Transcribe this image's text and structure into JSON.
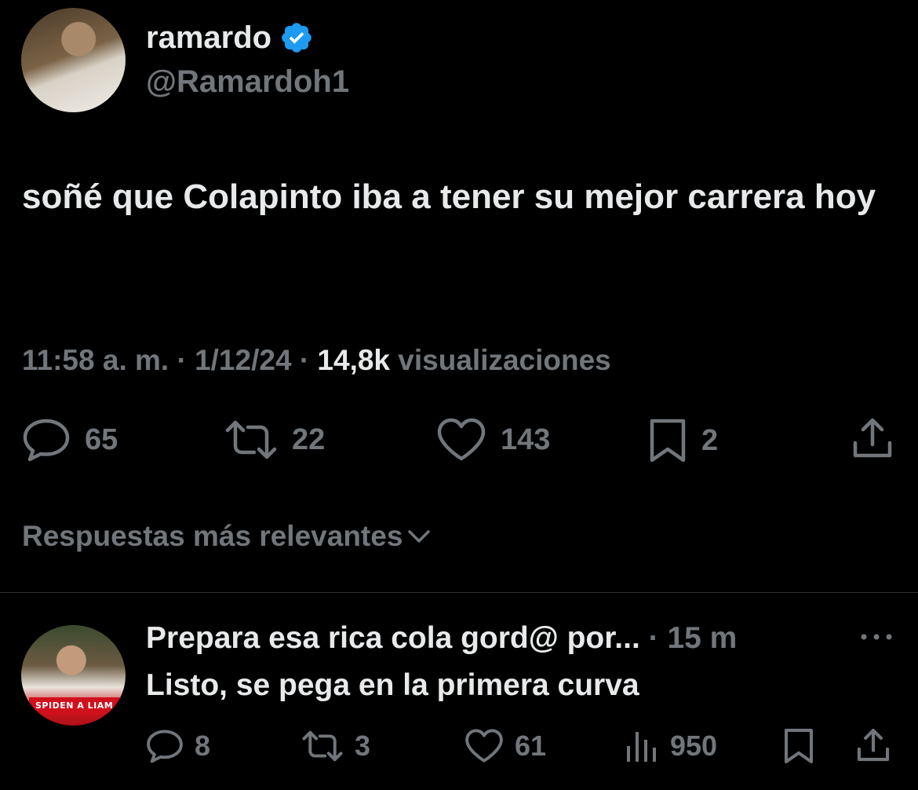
{
  "tweet": {
    "display_name": "ramardo",
    "handle": "@Ramardoh1",
    "verified": true,
    "verified_color": "#1d9bf0",
    "text": "soñé que Colapinto iba a tener su mejor carrera hoy",
    "time": "11:58 a. m.",
    "separator": "·",
    "date": "1/12/24",
    "views_count": "14,8k",
    "views_label": "visualizaciones",
    "actions": {
      "replies": "65",
      "retweets": "22",
      "likes": "143",
      "bookmarks": "2"
    },
    "icons": [
      "reply-icon",
      "retweet-icon",
      "like-icon",
      "bookmark-icon",
      "share-icon"
    ]
  },
  "replies_section": {
    "title": "Respuestas más relevantes"
  },
  "reply": {
    "author": "Prepara esa rica cola gord@ por...",
    "time": "· 15 m",
    "text": "Listo, se pega en la primera curva",
    "avatar_banner": "SPIDEN A LIAM",
    "actions": {
      "replies": "8",
      "retweets": "3",
      "likes": "61",
      "views": "950"
    }
  },
  "colors": {
    "background": "#000000",
    "primary_text": "#e7e9ea",
    "secondary_text": "#71767b",
    "divider": "#2f3336"
  }
}
